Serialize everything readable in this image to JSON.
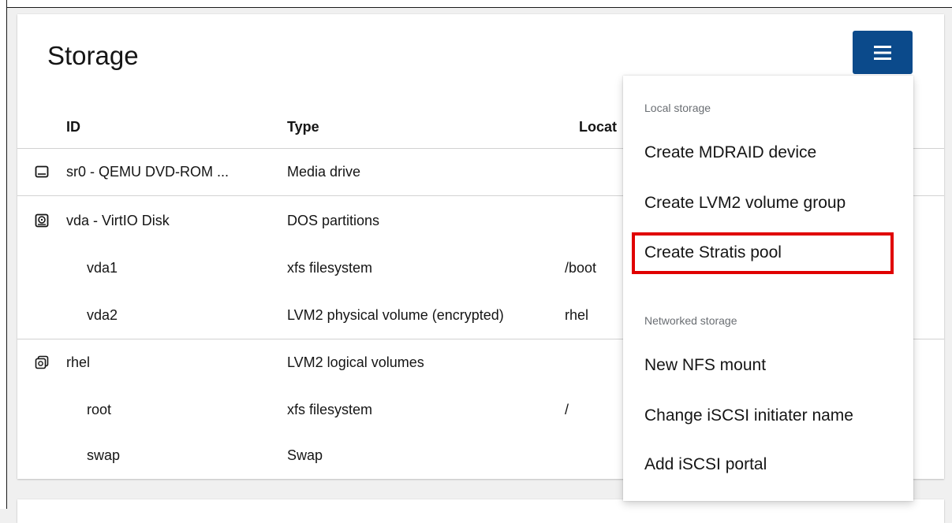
{
  "card": {
    "title": "Storage",
    "menu_icon": "hamburger-menu-icon"
  },
  "table": {
    "columns": [
      "ID",
      "Type",
      "Locat"
    ],
    "rows": [
      {
        "icon": "optical-drive-icon",
        "id": "sr0 - QEMU DVD-ROM ...",
        "type": "Media drive",
        "location": ""
      },
      {
        "icon": "disk-icon",
        "id": "vda - VirtIO Disk",
        "type": "DOS partitions",
        "location": ""
      },
      {
        "icon": "",
        "id": "vda1",
        "type": "xfs filesystem",
        "location": "/boot"
      },
      {
        "icon": "",
        "id": "vda2",
        "type": "LVM2 physical volume (encrypted)",
        "location": "rhel"
      },
      {
        "icon": "volume-group-icon",
        "id": "rhel",
        "type": "LVM2 logical volumes",
        "location": ""
      },
      {
        "icon": "",
        "id": "root",
        "type": "xfs filesystem",
        "location": "/"
      },
      {
        "icon": "",
        "id": "swap",
        "type": "Swap",
        "location": ""
      }
    ]
  },
  "dropdown": {
    "group1_label": "Local storage",
    "items_local": [
      "Create MDRAID device",
      "Create LVM2 volume group",
      "Create Stratis pool"
    ],
    "group2_label": "Networked storage",
    "items_network": [
      "New NFS mount",
      "Change iSCSI initiater name",
      "Add iSCSI portal"
    ]
  },
  "colors": {
    "menu_button": "#0b4a8b",
    "highlight_border": "#e00000"
  }
}
